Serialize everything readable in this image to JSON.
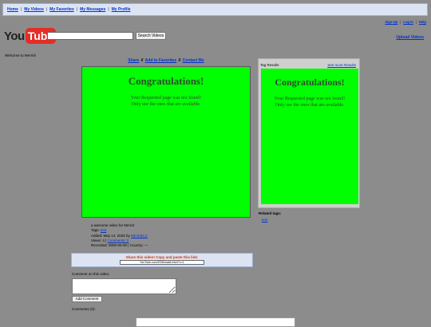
{
  "topnav": [
    "Home",
    "My Videos",
    "My Favorites",
    "My Messages",
    "My Profile"
  ],
  "userlinks": [
    "Sign Up",
    "Log In",
    "Help"
  ],
  "logo": {
    "you": "You",
    "tube": "Tube"
  },
  "search": {
    "value": "",
    "button": "Search Videos"
  },
  "upload_label": "Upload Videos",
  "welcome": "Welcome to MeVid!",
  "share_links": {
    "share": "Share",
    "favorites": "Add to Favorites",
    "contact": "Contact Me",
    "sep": "//"
  },
  "player": {
    "title": "Congratulations!",
    "line1": "Your Requested page was not found!",
    "line2": "Only use the ones that are available."
  },
  "video_info": {
    "description": "a welcome video for MeVid",
    "tags_label": "Tags:",
    "tag": "test",
    "added_label": "Added: May 14, 2025 by",
    "author": "MeVidLLC",
    "views_label": "Views: 4 |",
    "comments_link": "Comments: 0",
    "recorded": "Recorded: 0000-00-00 | Country: —"
  },
  "embed": {
    "title": "Share this video! Copy and paste this link:",
    "value": "YouTube.com/2005/watch.html?v=1"
  },
  "comment": {
    "label": "Comment on this video:",
    "button": "Add Comment",
    "count": "Comments (0):"
  },
  "sidebar": {
    "title": "Tag Results",
    "more": "See more Results",
    "panel_title": "Congratulations!",
    "panel_line1": "Your Requested page was not found!",
    "panel_line2": "Only use the ones that are available.",
    "related_title": "Related tags:",
    "related_tag": "test"
  },
  "colors": {
    "background": "#8c8c8c",
    "player_green": "#00ff00",
    "link_blue": "#0033cc",
    "logo_red": "#e32d26"
  }
}
